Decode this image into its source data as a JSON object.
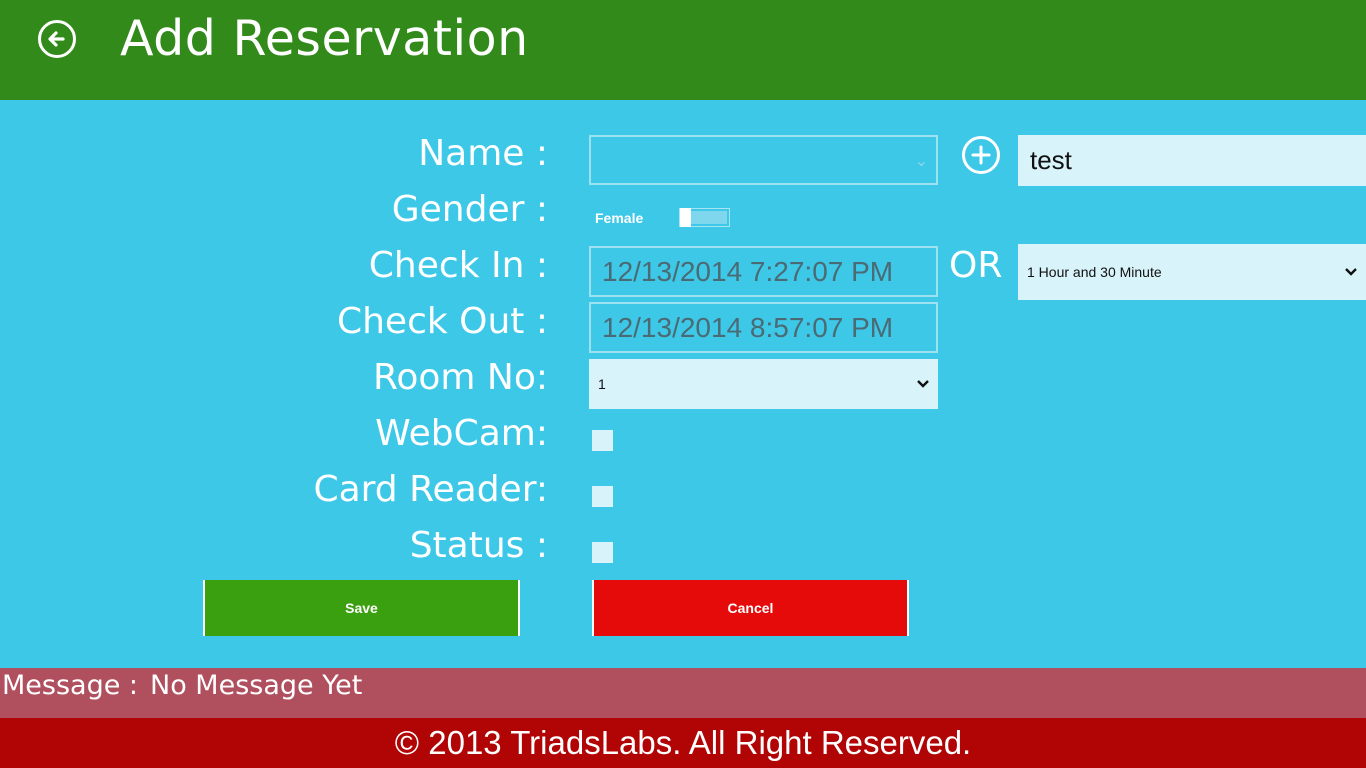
{
  "header": {
    "title": "Add Reservation"
  },
  "form": {
    "name_label": "Name :",
    "name_value": "test",
    "gender_label": "Gender :",
    "gender_value": "Female",
    "gender_toggle_on": false,
    "checkin_label": "Check In :",
    "checkin_value": "12/13/2014 7:27:07 PM",
    "or_label": "OR",
    "duration_value": "1 Hour and 30 Minute",
    "checkout_label": "Check Out :",
    "checkout_value": "12/13/2014 8:57:07 PM",
    "room_label": "Room No:",
    "room_value": "1",
    "webcam_label": "WebCam:",
    "webcam_checked": false,
    "cardreader_label": "Card Reader:",
    "cardreader_checked": false,
    "status_label": "Status :",
    "status_checked": false
  },
  "buttons": {
    "save": "Save",
    "cancel": "Cancel"
  },
  "message": {
    "label": "Message :",
    "value": "No Message Yet"
  },
  "footer": {
    "copyright": "© 2013 TriadsLabs. All Right Reserved."
  },
  "colors": {
    "header_bg": "#318a19",
    "body_bg": "#3ec8e8",
    "save_bg": "#3ba00f",
    "cancel_bg": "#e50b0b",
    "message_bg": "#b0505f",
    "footer_bg": "#b10505"
  },
  "icons": {
    "back": "back-arrow-icon",
    "add": "plus-circle-icon",
    "dropdown": "chevron-down-icon"
  }
}
